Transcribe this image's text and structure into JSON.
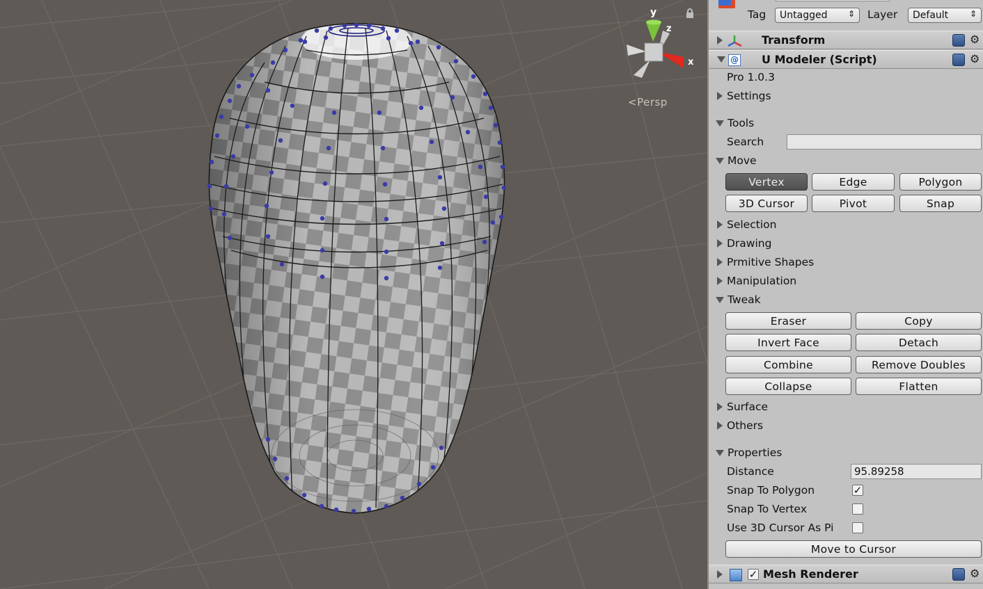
{
  "scene": {
    "camera_label": "Persp",
    "gizmo": {
      "x_label": "x",
      "y_label": "y",
      "z_label": "z"
    }
  },
  "inspector": {
    "tag_label": "Tag",
    "tag_value": "Untagged",
    "layer_label": "Layer",
    "layer_value": "Default",
    "components": {
      "transform": "Transform",
      "umodeler": "U Modeler (Script)",
      "mesh_renderer": "Mesh Renderer"
    },
    "version": "Pro 1.0.3",
    "sections": {
      "settings": "Settings",
      "tools": "Tools",
      "search_label": "Search",
      "search_value": "",
      "move": "Move",
      "selection": "Selection",
      "drawing": "Drawing",
      "primitive_shapes": "Prmitive Shapes",
      "manipulation": "Manipulation",
      "tweak": "Tweak",
      "surface": "Surface",
      "others": "Others",
      "properties": "Properties"
    },
    "move_buttons": [
      "Vertex",
      "Edge",
      "Polygon",
      "3D Cursor",
      "Pivot",
      "Snap"
    ],
    "move_active": "Vertex",
    "tweak_buttons": [
      "Eraser",
      "Copy",
      "Invert Face",
      "Detach",
      "Combine",
      "Remove Doubles",
      "Collapse",
      "Flatten"
    ],
    "properties": {
      "distance_label": "Distance",
      "distance_value": "95.89258",
      "snap_polygon_label": "Snap To Polygon",
      "snap_polygon_checked": true,
      "snap_vertex_label": "Snap To Vertex",
      "snap_vertex_checked": false,
      "use_cursor_label": "Use 3D Cursor As Pi",
      "use_cursor_checked": false,
      "move_to_cursor": "Move to Cursor"
    }
  },
  "colors": {
    "scene_bg": "#5f5a55",
    "vertex": "#3a3aa8",
    "inspector_bg": "#c2c2c2",
    "active_button": "#5a5a5a"
  }
}
